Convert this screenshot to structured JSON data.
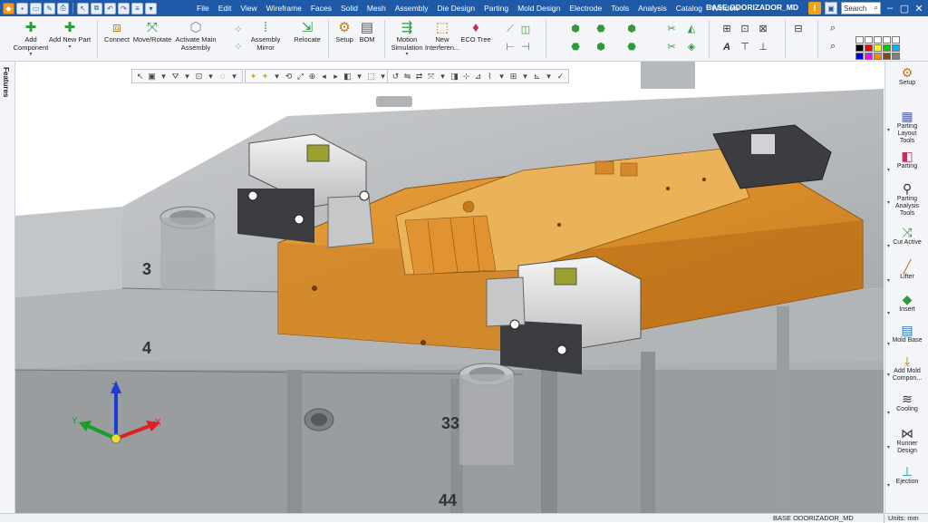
{
  "menu": {
    "items": [
      "File",
      "Edit",
      "View",
      "Wireframe",
      "Faces",
      "Solid",
      "Mesh",
      "Assembly",
      "Die Design",
      "Parting",
      "Mold Design",
      "Electrode",
      "Tools",
      "Analysis",
      "Catalog",
      "Window"
    ],
    "document_title": "BASE ODORIZADOR_MD",
    "search_placeholder": "Search",
    "warning_glyph": "!"
  },
  "ribbon": {
    "add_component": "Add\nComponent",
    "add_new_part": "Add New Part",
    "connect": "Connect",
    "move_rotate": "Move/Rotate",
    "activate_main_assembly": "Activate Main\nAssembly",
    "assembly_mirror": "Assembly\nMirror",
    "relocate": "Relocate",
    "setup": "Setup",
    "bom": "BOM",
    "motion_simulation": "Motion\nSimulation",
    "new_interference": "New\nInterferen...",
    "eco_tree": "ECO Tree"
  },
  "palette_colors": [
    "#ffffff",
    "#ffffff",
    "#ffffff",
    "#ffffff",
    "#ffffff",
    "#000000",
    "#ff0000",
    "#ffff00",
    "#00cc00",
    "#00b0f0",
    "#0000ff",
    "#ff00ff",
    "#ff8c00",
    "#8b4513",
    "#808080"
  ],
  "features_tab": "Features",
  "right_panel": {
    "items": [
      "Setup",
      "Parting\nLayout\nTools",
      "Parting",
      "Parting\nAnalysis\nTools",
      "Cut Active",
      "Lifter",
      "Insert",
      "Mold Base",
      "Add Mold\nCompon...",
      "Cooling",
      "Runner\nDesign",
      "Ejection"
    ]
  },
  "viewport": {
    "plate_labels": [
      "3",
      "4",
      "33",
      "44"
    ],
    "triad": {
      "x": "X",
      "y": "Y",
      "z": "Z"
    }
  },
  "status": {
    "document": "BASE ODORIZADOR_MD",
    "units": "Units: mm"
  }
}
